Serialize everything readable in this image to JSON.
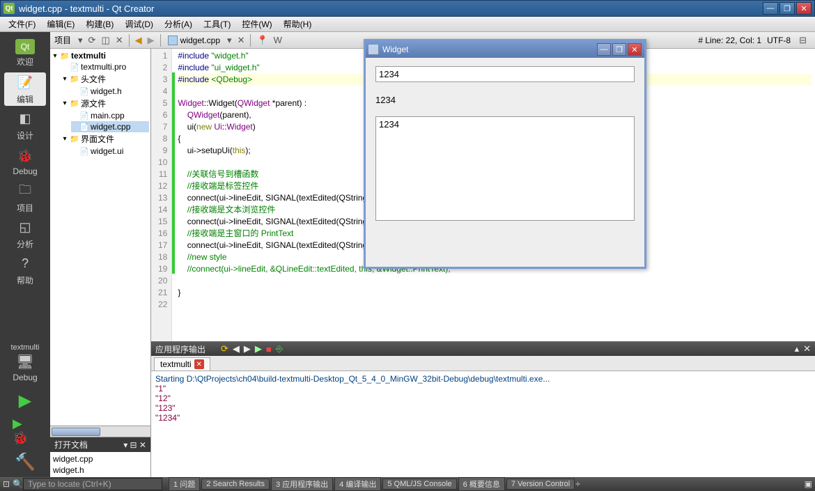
{
  "window": {
    "title": "widget.cpp - textmulti - Qt Creator"
  },
  "menu": [
    "文件(F)",
    "编辑(E)",
    "构建(B)",
    "调试(D)",
    "分析(A)",
    "工具(T)",
    "控件(W)",
    "帮助(H)"
  ],
  "modebar": {
    "items": [
      {
        "label": "欢迎",
        "icon": "Qt"
      },
      {
        "label": "编辑",
        "icon": "✎",
        "active": true
      },
      {
        "label": "设计",
        "icon": "◧"
      },
      {
        "label": "Debug",
        "icon": "🐞"
      },
      {
        "label": "项目",
        "icon": "📁"
      },
      {
        "label": "分析",
        "icon": "◱"
      },
      {
        "label": "帮助",
        "icon": "?"
      }
    ],
    "kit": {
      "name": "textmulti",
      "config": "Debug"
    }
  },
  "toptools": {
    "projectLabel": "项目",
    "filetab": "widget.cpp",
    "status": "# Line: 22, Col: 1",
    "encoding": "UTF-8"
  },
  "project": {
    "root": "textmulti",
    "pro": "textmulti.pro",
    "headers": {
      "label": "头文件",
      "items": [
        "widget.h"
      ]
    },
    "sources": {
      "label": "源文件",
      "items": [
        "main.cpp",
        "widget.cpp"
      ]
    },
    "forms": {
      "label": "界面文件",
      "items": [
        "widget.ui"
      ]
    }
  },
  "openfiles": {
    "header": "打开文档",
    "items": [
      "widget.cpp",
      "widget.h"
    ]
  },
  "code": {
    "lines": [
      {
        "n": 1,
        "html": "<span class='pp'>#include</span> <span class='str'>\"widget.h\"</span>"
      },
      {
        "n": 2,
        "html": "<span class='pp'>#include</span> <span class='str'>\"ui_widget.h\"</span>"
      },
      {
        "n": 3,
        "html": "<span class='pp'>#include</span> <span class='str'>&lt;QDebug&gt;</span>",
        "cur": true
      },
      {
        "n": 4,
        "html": ""
      },
      {
        "n": 5,
        "html": "<span class='ty'>Widget</span>::<span class='fn'>Widget</span>(<span class='ty'>QWidget</span> *parent) :"
      },
      {
        "n": 6,
        "html": "    <span class='ty'>QWidget</span>(parent),"
      },
      {
        "n": 7,
        "html": "    ui(<span class='kw'>new</span> <span class='ty'>Ui</span>::<span class='ty'>Widget</span>)"
      },
      {
        "n": 8,
        "html": "{"
      },
      {
        "n": 9,
        "html": "    ui-&gt;setupUi(<span class='kw'>this</span>);"
      },
      {
        "n": 10,
        "html": ""
      },
      {
        "n": 11,
        "html": "    <span class='cm'>//关联信号到槽函数</span>"
      },
      {
        "n": 12,
        "html": "    <span class='cm'>//接收端是标签控件</span>"
      },
      {
        "n": 13,
        "html": "    connect(ui-&gt;lineEdit, SIGNAL(textEdited(QString)), ui-&gt;label, SLOT(setText(<span class='ty'>QString</span>)));"
      },
      {
        "n": 14,
        "html": "    <span class='cm'>//接收端是文本浏览控件</span>"
      },
      {
        "n": 15,
        "html": "    connect(ui-&gt;lineEdit, SIGNAL(textEdited(QString)), ui-&gt;textBrowser, SLOT(setText(<span class='ty'>QString</span>)));"
      },
      {
        "n": 16,
        "html": "    <span class='cm'>//接收端是主窗口的 PrintText</span>"
      },
      {
        "n": 17,
        "html": "    connect(ui-&gt;lineEdit, SIGNAL(textEdited(QString)), this, SLOT(PrintText(<span class='ty'>QString</span>)));"
      },
      {
        "n": 18,
        "html": "    <span class='cm'>//new style</span>"
      },
      {
        "n": 19,
        "html": "    <span class='cm'>//connect(ui-&gt;lineEdit, &amp;QLineEdit::textEdited, this, &amp;Widget::PrintText);</span>"
      },
      {
        "n": 20,
        "html": ""
      },
      {
        "n": 21,
        "html": "}"
      },
      {
        "n": 22,
        "html": ""
      }
    ]
  },
  "output": {
    "title": "应用程序输出",
    "tab": "textmulti",
    "lines": [
      {
        "cls": "o1",
        "text": "Starting D:\\QtProjects\\ch04\\build-textmulti-Desktop_Qt_5_4_0_MinGW_32bit-Debug\\debug\\textmulti.exe..."
      },
      {
        "cls": "o2",
        "text": "\"1\""
      },
      {
        "cls": "o2",
        "text": "\"12\""
      },
      {
        "cls": "o2",
        "text": "\"123\""
      },
      {
        "cls": "o2",
        "text": "\"1234\""
      }
    ]
  },
  "statusbar": {
    "locator": "Type to locate (Ctrl+K)",
    "tabs": [
      "1 问题",
      "2 Search Results",
      "3 应用程序输出",
      "4 编译输出",
      "5 QML/JS Console",
      "6 概要信息",
      "7 Version Control"
    ]
  },
  "runwin": {
    "title": "Widget",
    "lineedit": "1234",
    "label": "1234",
    "textarea": "1234"
  }
}
